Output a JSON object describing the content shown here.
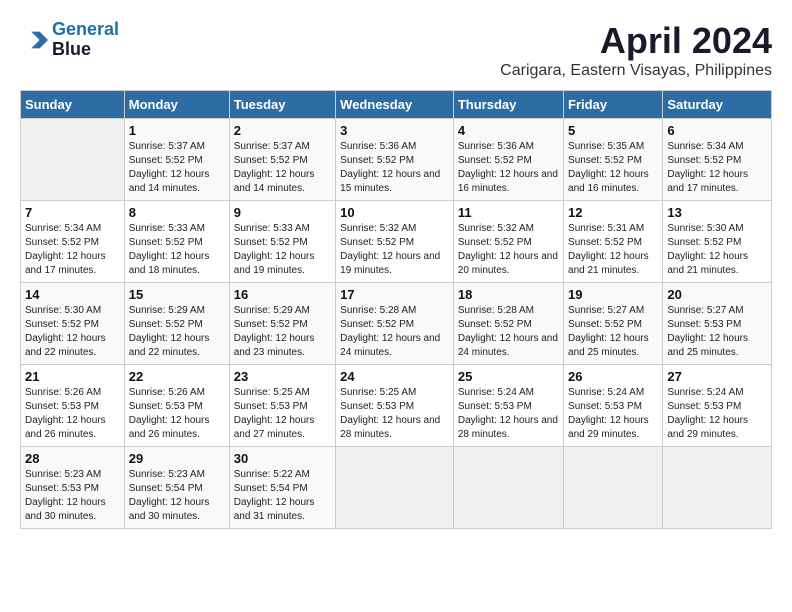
{
  "logo": {
    "line1": "General",
    "line2": "Blue"
  },
  "title": "April 2024",
  "subtitle": "Carigara, Eastern Visayas, Philippines",
  "days_of_week": [
    "Sunday",
    "Monday",
    "Tuesday",
    "Wednesday",
    "Thursday",
    "Friday",
    "Saturday"
  ],
  "weeks": [
    [
      {
        "day": "",
        "sunrise": "",
        "sunset": "",
        "daylight": ""
      },
      {
        "day": "1",
        "sunrise": "Sunrise: 5:37 AM",
        "sunset": "Sunset: 5:52 PM",
        "daylight": "Daylight: 12 hours and 14 minutes."
      },
      {
        "day": "2",
        "sunrise": "Sunrise: 5:37 AM",
        "sunset": "Sunset: 5:52 PM",
        "daylight": "Daylight: 12 hours and 14 minutes."
      },
      {
        "day": "3",
        "sunrise": "Sunrise: 5:36 AM",
        "sunset": "Sunset: 5:52 PM",
        "daylight": "Daylight: 12 hours and 15 minutes."
      },
      {
        "day": "4",
        "sunrise": "Sunrise: 5:36 AM",
        "sunset": "Sunset: 5:52 PM",
        "daylight": "Daylight: 12 hours and 16 minutes."
      },
      {
        "day": "5",
        "sunrise": "Sunrise: 5:35 AM",
        "sunset": "Sunset: 5:52 PM",
        "daylight": "Daylight: 12 hours and 16 minutes."
      },
      {
        "day": "6",
        "sunrise": "Sunrise: 5:34 AM",
        "sunset": "Sunset: 5:52 PM",
        "daylight": "Daylight: 12 hours and 17 minutes."
      }
    ],
    [
      {
        "day": "7",
        "sunrise": "Sunrise: 5:34 AM",
        "sunset": "Sunset: 5:52 PM",
        "daylight": "Daylight: 12 hours and 17 minutes."
      },
      {
        "day": "8",
        "sunrise": "Sunrise: 5:33 AM",
        "sunset": "Sunset: 5:52 PM",
        "daylight": "Daylight: 12 hours and 18 minutes."
      },
      {
        "day": "9",
        "sunrise": "Sunrise: 5:33 AM",
        "sunset": "Sunset: 5:52 PM",
        "daylight": "Daylight: 12 hours and 19 minutes."
      },
      {
        "day": "10",
        "sunrise": "Sunrise: 5:32 AM",
        "sunset": "Sunset: 5:52 PM",
        "daylight": "Daylight: 12 hours and 19 minutes."
      },
      {
        "day": "11",
        "sunrise": "Sunrise: 5:32 AM",
        "sunset": "Sunset: 5:52 PM",
        "daylight": "Daylight: 12 hours and 20 minutes."
      },
      {
        "day": "12",
        "sunrise": "Sunrise: 5:31 AM",
        "sunset": "Sunset: 5:52 PM",
        "daylight": "Daylight: 12 hours and 21 minutes."
      },
      {
        "day": "13",
        "sunrise": "Sunrise: 5:30 AM",
        "sunset": "Sunset: 5:52 PM",
        "daylight": "Daylight: 12 hours and 21 minutes."
      }
    ],
    [
      {
        "day": "14",
        "sunrise": "Sunrise: 5:30 AM",
        "sunset": "Sunset: 5:52 PM",
        "daylight": "Daylight: 12 hours and 22 minutes."
      },
      {
        "day": "15",
        "sunrise": "Sunrise: 5:29 AM",
        "sunset": "Sunset: 5:52 PM",
        "daylight": "Daylight: 12 hours and 22 minutes."
      },
      {
        "day": "16",
        "sunrise": "Sunrise: 5:29 AM",
        "sunset": "Sunset: 5:52 PM",
        "daylight": "Daylight: 12 hours and 23 minutes."
      },
      {
        "day": "17",
        "sunrise": "Sunrise: 5:28 AM",
        "sunset": "Sunset: 5:52 PM",
        "daylight": "Daylight: 12 hours and 24 minutes."
      },
      {
        "day": "18",
        "sunrise": "Sunrise: 5:28 AM",
        "sunset": "Sunset: 5:52 PM",
        "daylight": "Daylight: 12 hours and 24 minutes."
      },
      {
        "day": "19",
        "sunrise": "Sunrise: 5:27 AM",
        "sunset": "Sunset: 5:52 PM",
        "daylight": "Daylight: 12 hours and 25 minutes."
      },
      {
        "day": "20",
        "sunrise": "Sunrise: 5:27 AM",
        "sunset": "Sunset: 5:53 PM",
        "daylight": "Daylight: 12 hours and 25 minutes."
      }
    ],
    [
      {
        "day": "21",
        "sunrise": "Sunrise: 5:26 AM",
        "sunset": "Sunset: 5:53 PM",
        "daylight": "Daylight: 12 hours and 26 minutes."
      },
      {
        "day": "22",
        "sunrise": "Sunrise: 5:26 AM",
        "sunset": "Sunset: 5:53 PM",
        "daylight": "Daylight: 12 hours and 26 minutes."
      },
      {
        "day": "23",
        "sunrise": "Sunrise: 5:25 AM",
        "sunset": "Sunset: 5:53 PM",
        "daylight": "Daylight: 12 hours and 27 minutes."
      },
      {
        "day": "24",
        "sunrise": "Sunrise: 5:25 AM",
        "sunset": "Sunset: 5:53 PM",
        "daylight": "Daylight: 12 hours and 28 minutes."
      },
      {
        "day": "25",
        "sunrise": "Sunrise: 5:24 AM",
        "sunset": "Sunset: 5:53 PM",
        "daylight": "Daylight: 12 hours and 28 minutes."
      },
      {
        "day": "26",
        "sunrise": "Sunrise: 5:24 AM",
        "sunset": "Sunset: 5:53 PM",
        "daylight": "Daylight: 12 hours and 29 minutes."
      },
      {
        "day": "27",
        "sunrise": "Sunrise: 5:24 AM",
        "sunset": "Sunset: 5:53 PM",
        "daylight": "Daylight: 12 hours and 29 minutes."
      }
    ],
    [
      {
        "day": "28",
        "sunrise": "Sunrise: 5:23 AM",
        "sunset": "Sunset: 5:53 PM",
        "daylight": "Daylight: 12 hours and 30 minutes."
      },
      {
        "day": "29",
        "sunrise": "Sunrise: 5:23 AM",
        "sunset": "Sunset: 5:54 PM",
        "daylight": "Daylight: 12 hours and 30 minutes."
      },
      {
        "day": "30",
        "sunrise": "Sunrise: 5:22 AM",
        "sunset": "Sunset: 5:54 PM",
        "daylight": "Daylight: 12 hours and 31 minutes."
      },
      {
        "day": "",
        "sunrise": "",
        "sunset": "",
        "daylight": ""
      },
      {
        "day": "",
        "sunrise": "",
        "sunset": "",
        "daylight": ""
      },
      {
        "day": "",
        "sunrise": "",
        "sunset": "",
        "daylight": ""
      },
      {
        "day": "",
        "sunrise": "",
        "sunset": "",
        "daylight": ""
      }
    ]
  ]
}
